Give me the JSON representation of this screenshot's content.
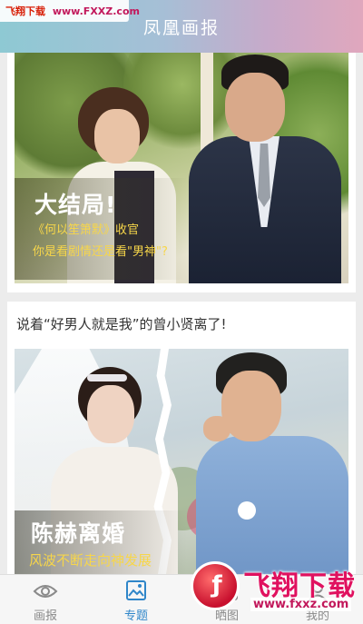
{
  "header": {
    "title": "凤凰画报",
    "watermark_brand": "飞翔下载",
    "watermark_url": "www.FXXZ.com"
  },
  "feed": {
    "cards": [
      {
        "title": "大结局!",
        "subtitle_line1": "《何以笙箫默》收官",
        "subtitle_line2": "你是看剧情还是看\"男神\"?"
      },
      {
        "headline": "说着“好男人就是我”的曾小贤离了!",
        "title": "陈赫离婚",
        "subtitle_line1": "风波不断走向神发展"
      }
    ]
  },
  "bottom_nav": {
    "items": [
      {
        "label": "画报",
        "icon": "eye-icon",
        "active": false
      },
      {
        "label": "专题",
        "icon": "image-icon",
        "active": true
      },
      {
        "label": "晒图",
        "icon": "camera-icon",
        "active": false
      },
      {
        "label": "我的",
        "icon": "user-icon",
        "active": false
      }
    ],
    "active_color": "#2f86c9"
  },
  "watermark": {
    "name": "飞翔下载",
    "url": "www.fxxz.com"
  },
  "colors": {
    "header_gradient_start": "#8ec9d3",
    "header_gradient_end": "#e0a7bd",
    "caption_accent": "#f7d64a",
    "watermark_red": "#e0115f"
  }
}
